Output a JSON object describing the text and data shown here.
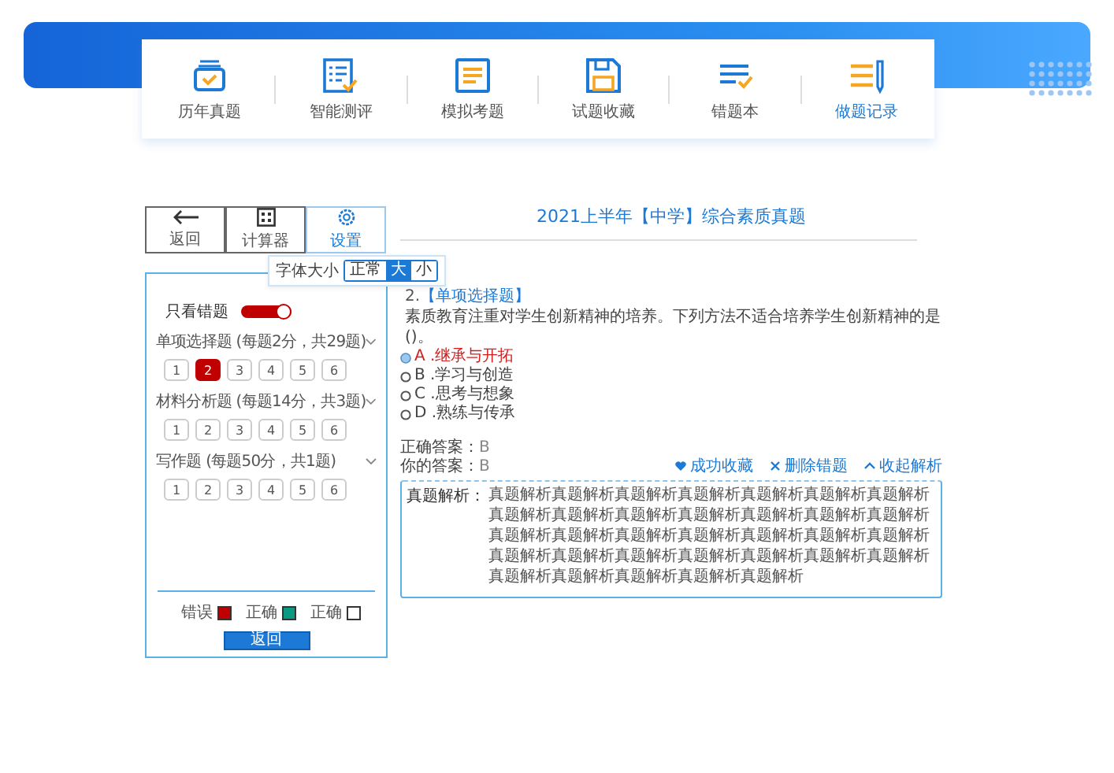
{
  "nav": [
    {
      "label": "历年真题",
      "kind": "box",
      "selected": false
    },
    {
      "label": "智能测评",
      "kind": "list",
      "selected": false
    },
    {
      "label": "模拟考题",
      "kind": "doc",
      "selected": false
    },
    {
      "label": "试题收藏",
      "kind": "save",
      "selected": false
    },
    {
      "label": "错题本",
      "kind": "lines",
      "selected": false
    },
    {
      "label": "做题记录",
      "kind": "pen",
      "selected": true
    }
  ],
  "toolbar": [
    {
      "label": "返回",
      "kind": "back",
      "selected": false
    },
    {
      "label": "计算器",
      "kind": "calculator",
      "selected": false
    },
    {
      "label": "设置",
      "kind": "settings",
      "selected": true
    }
  ],
  "font_size": {
    "label": "字体大小",
    "options": [
      {
        "label": "正常",
        "selected": false
      },
      {
        "label": "大",
        "selected": true
      },
      {
        "label": "小",
        "selected": false
      }
    ]
  },
  "sidebar": {
    "wrong_only": {
      "label": "只看错题",
      "on": true
    },
    "sections": [
      {
        "title": "单项选择题 (每题2分，共29题)",
        "numbers": [
          {
            "label": "1",
            "kind": "none"
          },
          {
            "label": "2",
            "kind": "wrong"
          },
          {
            "label": "3",
            "kind": "none"
          },
          {
            "label": "4",
            "kind": "none"
          },
          {
            "label": "5",
            "kind": "none"
          },
          {
            "label": "6",
            "kind": "none"
          }
        ]
      },
      {
        "title": "材料分析题 (每题14分，共3题)",
        "numbers": [
          {
            "label": "1",
            "kind": "none"
          },
          {
            "label": "2",
            "kind": "none"
          },
          {
            "label": "3",
            "kind": "none"
          },
          {
            "label": "4",
            "kind": "none"
          },
          {
            "label": "5",
            "kind": "none"
          },
          {
            "label": "6",
            "kind": "none"
          }
        ]
      },
      {
        "title": "写作题 (每题50分，共1题)",
        "numbers": [
          {
            "label": "1",
            "kind": "none"
          },
          {
            "label": "2",
            "kind": "none"
          },
          {
            "label": "3",
            "kind": "none"
          },
          {
            "label": "4",
            "kind": "none"
          },
          {
            "label": "5",
            "kind": "none"
          },
          {
            "label": "6",
            "kind": "none"
          }
        ]
      }
    ],
    "legend": [
      {
        "label": "错误",
        "color": "#c00000"
      },
      {
        "label": "正确",
        "color": "#0a9a82"
      },
      {
        "label": "正确",
        "color": "#ffffff"
      }
    ],
    "button": "返回"
  },
  "question": {
    "title": "2021上半年【中学】综合素质真题",
    "number": "2.",
    "type": "【单项选择题】",
    "stem": "素质教育注重对学生创新精神的培养。下列方法不适合培养学生创新精神的是()。",
    "options": [
      {
        "label": "A .继承与开拓",
        "selected": true
      },
      {
        "label": "B .学习与创造",
        "selected": false
      },
      {
        "label": "C .思考与想象",
        "selected": false
      },
      {
        "label": "D .熟练与传承",
        "selected": false
      }
    ],
    "answers": [
      {
        "label": "正确答案：",
        "value": "B"
      },
      {
        "label": "你的答案：",
        "value": "B"
      }
    ],
    "actions": [
      {
        "label": "成功收藏",
        "kind": "heart"
      },
      {
        "label": "删除错题",
        "kind": "close"
      },
      {
        "label": "收起解析",
        "kind": "up"
      }
    ],
    "analysis": {
      "label": "真题解析：",
      "text": "真题解析真题解析真题解析真题解析真题解析真题解析真题解析真题解析真题解析真题解析真题解析真题解析真题解析真题解析真题解析真题解析真题解析真题解析真题解析真题解析真题解析真题解析真题解析真题解析真题解析真题解析真题解析真题解析真题解析真题解析真题解析真题解析真题解析"
    }
  }
}
